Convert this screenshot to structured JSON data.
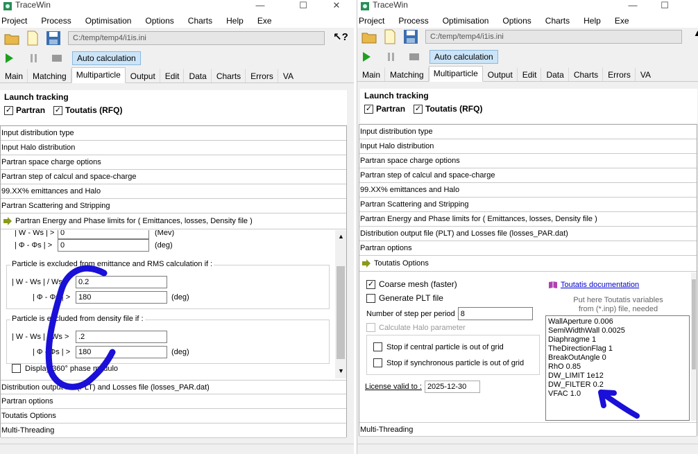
{
  "left": {
    "title": "TraceWin",
    "menu": [
      "Project",
      "Process",
      "Optimisation",
      "Options",
      "Charts",
      "Help",
      "Exe"
    ],
    "path": "C:/temp/temp4/i1is.ini",
    "auto_calc": "Auto calculation",
    "tabs": [
      "Main",
      "Matching",
      "Multiparticle",
      "Output",
      "Edit",
      "Data",
      "Charts",
      "Errors",
      "VA"
    ],
    "launch_title": "Launch tracking",
    "partran": "Partran",
    "toutatis": "Toutatis (RFQ)",
    "sections_top": [
      "Input distribution type",
      "Input Halo distribution",
      "Partran space charge options",
      "Partran step of calcul and space-charge",
      "99.XX% emittances and Halo",
      "Partran Scattering and Stripping"
    ],
    "open_section": "Partran Energy and Phase limits for ( Emittances, losses, Density file )",
    "limits": {
      "row_w_partial": "| W - Ws | >",
      "w_val_top": "0",
      "w_unit_top": "(Mev)",
      "row_phi": "| Φ - Φs | >",
      "phi_val_top": "0",
      "phi_unit": "(deg)",
      "group1_label": "Particle is excluded from emittance and RMS calculation if :",
      "g1_w_label": "| W - Ws | / Ws >",
      "g1_w_val": "0.2",
      "g1_phi_label": "| Φ - Φs | >",
      "g1_phi_val": "180",
      "g1_phi_unit": "(deg)",
      "group2_label": "Particle is excluded from density file if :",
      "g2_w_label": "| W - Ws | / Ws >",
      "g2_w_val": ".2",
      "g2_phi_label": "| Φ - Φs | >",
      "g2_phi_val": "180",
      "g2_phi_unit": "(deg)",
      "display_360": "Display 360° phase modulo"
    },
    "sections_bottom": [
      "Distribution output file (PLT) and Losses file (losses_PAR.dat)",
      "Partran options",
      "Toutatis Options",
      "Multi-Threading"
    ]
  },
  "right": {
    "title": "TraceWin",
    "menu": [
      "Project",
      "Process",
      "Optimisation",
      "Options",
      "Charts",
      "Help",
      "Exe"
    ],
    "path": "C:/temp/temp4/i1is.ini",
    "auto_calc": "Auto calculation",
    "tabs": [
      "Main",
      "Matching",
      "Multiparticle",
      "Output",
      "Edit",
      "Data",
      "Charts",
      "Errors",
      "VA"
    ],
    "launch_title": "Launch tracking",
    "partran": "Partran",
    "toutatis": "Toutatis (RFQ)",
    "sections_top": [
      "Input distribution type",
      "Input Halo distribution",
      "Partran space charge options",
      "Partran step of calcul and space-charge",
      "99.XX% emittances and Halo",
      "Partran Scattering and Stripping",
      "Partran Energy and Phase limits for ( Emittances, losses, Density file )",
      "Distribution output file (PLT) and Losses file (losses_PAR.dat)",
      "Partran options"
    ],
    "open_section": "Toutatis Options",
    "toutatis_opts": {
      "coarse_mesh": "Coarse mesh (faster)",
      "generate_plt": "Generate PLT file",
      "steps_label": "Number of step per period",
      "steps_value": "8",
      "calc_halo": "Calculate Halo parameter",
      "stop_central": "Stop if central particle is out of grid",
      "stop_sync": "Stop if synchronous particle is out of grid",
      "license_label": "License valid to :",
      "license_value": "2025-12-30",
      "doc_link": "Toutatis documentation",
      "hint_line1": "Put here Toutatis variables",
      "hint_line2": "from (*.inp) file, needed",
      "variables": [
        "WallAperture 0.006",
        "SemiWidthWall 0.0025",
        "Diaphragme 1",
        "TheDirectionFlag 1",
        "BreakOutAngle 0",
        "RhO 0.85",
        "DW_LIMIT 1e12",
        "DW_FILTER 0.2",
        "VFAC 1.0"
      ]
    },
    "sections_bottom": [
      "Multi-Threading"
    ]
  },
  "colors": {
    "annotation": "#1a10d8",
    "accent": "#2e8b57",
    "tab_active": "#ffffff"
  }
}
